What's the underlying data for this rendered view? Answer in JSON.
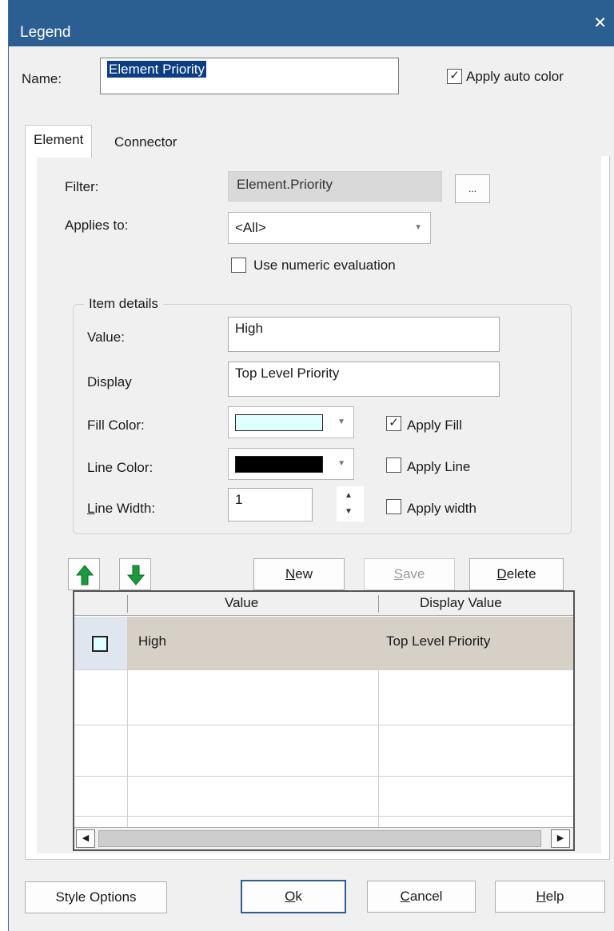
{
  "window": {
    "title": "Legend",
    "close_label": "✕"
  },
  "name_field": {
    "label": "Name:",
    "value": "Element Priority"
  },
  "apply_auto_color": {
    "label": "Apply auto color",
    "checked": true
  },
  "tabs": [
    {
      "label": "Element",
      "active": true
    },
    {
      "label": "Connector",
      "active": false
    }
  ],
  "filter": {
    "label": "Filter:",
    "value": "Element.Priority",
    "browse_label": "..."
  },
  "applies_to": {
    "label": "Applies to:",
    "selected": "<All>"
  },
  "numeric_eval": {
    "label": "Use numeric evaluation",
    "checked": false
  },
  "item_details": {
    "legend": "Item details",
    "value_label": "Value:",
    "value": "High",
    "display_label": "Display",
    "display": "Top Level Priority",
    "fill_color_label": "Fill Color:",
    "fill_color": "#e0ffff",
    "apply_fill_label": "Apply Fill",
    "apply_fill": true,
    "line_color_label": "Line Color:",
    "line_color": "#000000",
    "apply_line_label": "Apply Line",
    "apply_line": false,
    "line_width_label_first": "L",
    "line_width_label_rest": "ine Width:",
    "line_width": "1",
    "apply_width_label": "Apply width",
    "apply_width": false
  },
  "buttons": {
    "move_up_icon": "arrow-up-icon",
    "move_down_icon": "arrow-down-icon",
    "new_first": "N",
    "new_rest": "ew",
    "save_first": "S",
    "save_rest": "ave",
    "delete_first": "D",
    "delete_rest": "elete",
    "style_options": "Style Options",
    "ok_first": "O",
    "ok_rest": "k",
    "cancel_first": "C",
    "cancel_rest": "ancel",
    "help_first": "H",
    "help_rest": "elp"
  },
  "grid": {
    "headers": [
      "Value",
      "Display Value"
    ],
    "rows": [
      {
        "value": "High",
        "display": "Top Level Priority",
        "color": "#e0ffff"
      }
    ]
  },
  "colors": {
    "title_bar": "#2b5f91",
    "selected_row": "#d6d0c7",
    "arrow_green": "#1a9a3a"
  }
}
